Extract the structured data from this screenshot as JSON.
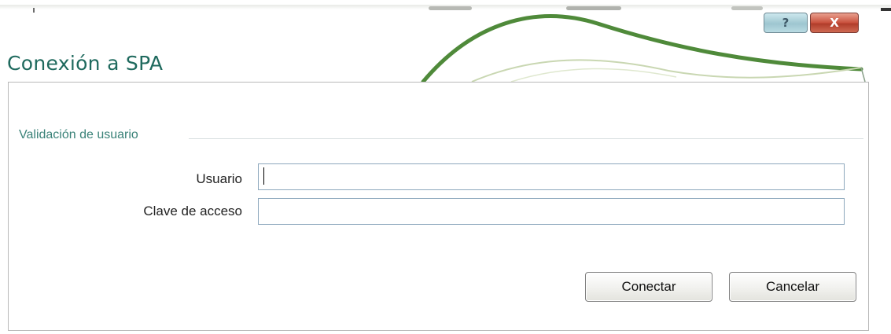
{
  "window": {
    "title": "Conexión a SPA",
    "help_glyph": "?",
    "close_glyph": "X"
  },
  "form": {
    "group_label": "Validación de usuario",
    "user_label": "Usuario",
    "user_value": "",
    "password_label": "Clave de acceso",
    "password_value": ""
  },
  "buttons": {
    "connect_label": "Conectar",
    "cancel_label": "Cancelar"
  },
  "icons": [
    "help-icon",
    "close-icon"
  ],
  "colors": {
    "title": "#1f6a5e",
    "group_label": "#3a8278",
    "swoosh": "#4f8a3a",
    "close_button": "#c9513d",
    "help_button": "#9ec6d0"
  }
}
